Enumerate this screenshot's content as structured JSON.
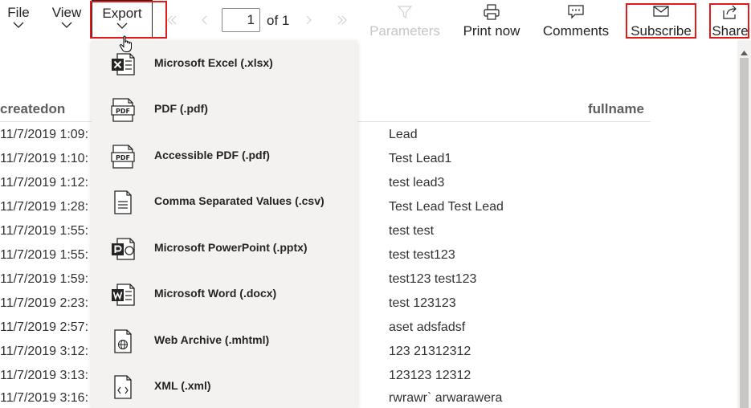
{
  "toolbar": {
    "file_label": "File",
    "view_label": "View",
    "export_label": "Export",
    "page_number": "1",
    "page_of": "of 1",
    "parameters_label": "Parameters",
    "print_label": "Print now",
    "comments_label": "Comments",
    "subscribe_label": "Subscribe",
    "share_label": "Share"
  },
  "export_menu": {
    "items": [
      {
        "label": "Microsoft Excel (.xlsx)",
        "icon": "excel-icon"
      },
      {
        "label": "PDF (.pdf)",
        "icon": "pdf-icon"
      },
      {
        "label": "Accessible PDF (.pdf)",
        "icon": "pdf-icon"
      },
      {
        "label": "Comma Separated Values (.csv)",
        "icon": "csv-icon"
      },
      {
        "label": "Microsoft PowerPoint (.pptx)",
        "icon": "powerpoint-icon"
      },
      {
        "label": "Microsoft Word (.docx)",
        "icon": "word-icon"
      },
      {
        "label": "Web Archive (.mhtml)",
        "icon": "web-archive-icon"
      },
      {
        "label": "XML (.xml)",
        "icon": "xml-icon"
      }
    ]
  },
  "report": {
    "col_createdon": "createdon",
    "col_fullname": "fullname",
    "rows": [
      {
        "createdon": "11/7/2019 1:09:",
        "fullname": "Lead"
      },
      {
        "createdon": "11/7/2019 1:10:",
        "fullname": "Test Lead1"
      },
      {
        "createdon": "11/7/2019 1:12:",
        "fullname": "test lead3"
      },
      {
        "createdon": "11/7/2019 1:28:",
        "fullname": "Test Lead Test Lead"
      },
      {
        "createdon": "11/7/2019 1:55:",
        "fullname": "test test"
      },
      {
        "createdon": "11/7/2019 1:55:",
        "fullname": "test test123"
      },
      {
        "createdon": "11/7/2019 1:59:",
        "fullname": "test123 test123"
      },
      {
        "createdon": "11/7/2019 2:23:",
        "fullname": "test 123123"
      },
      {
        "createdon": "11/7/2019 2:57:",
        "fullname": "aset adsfadsf"
      },
      {
        "createdon": "11/7/2019 3:12:",
        "fullname": "123 21312312"
      },
      {
        "createdon": "11/7/2019 3:13:",
        "fullname": "123123 12312"
      },
      {
        "createdon": "11/7/2019 3:16:",
        "fullname": "rwrawr` arwarawera"
      }
    ]
  },
  "colors": {
    "highlight_box": "#e01b1b",
    "menu_bg": "#f3f2f1",
    "text": "#252423",
    "disabled": "#c8c6c4"
  }
}
